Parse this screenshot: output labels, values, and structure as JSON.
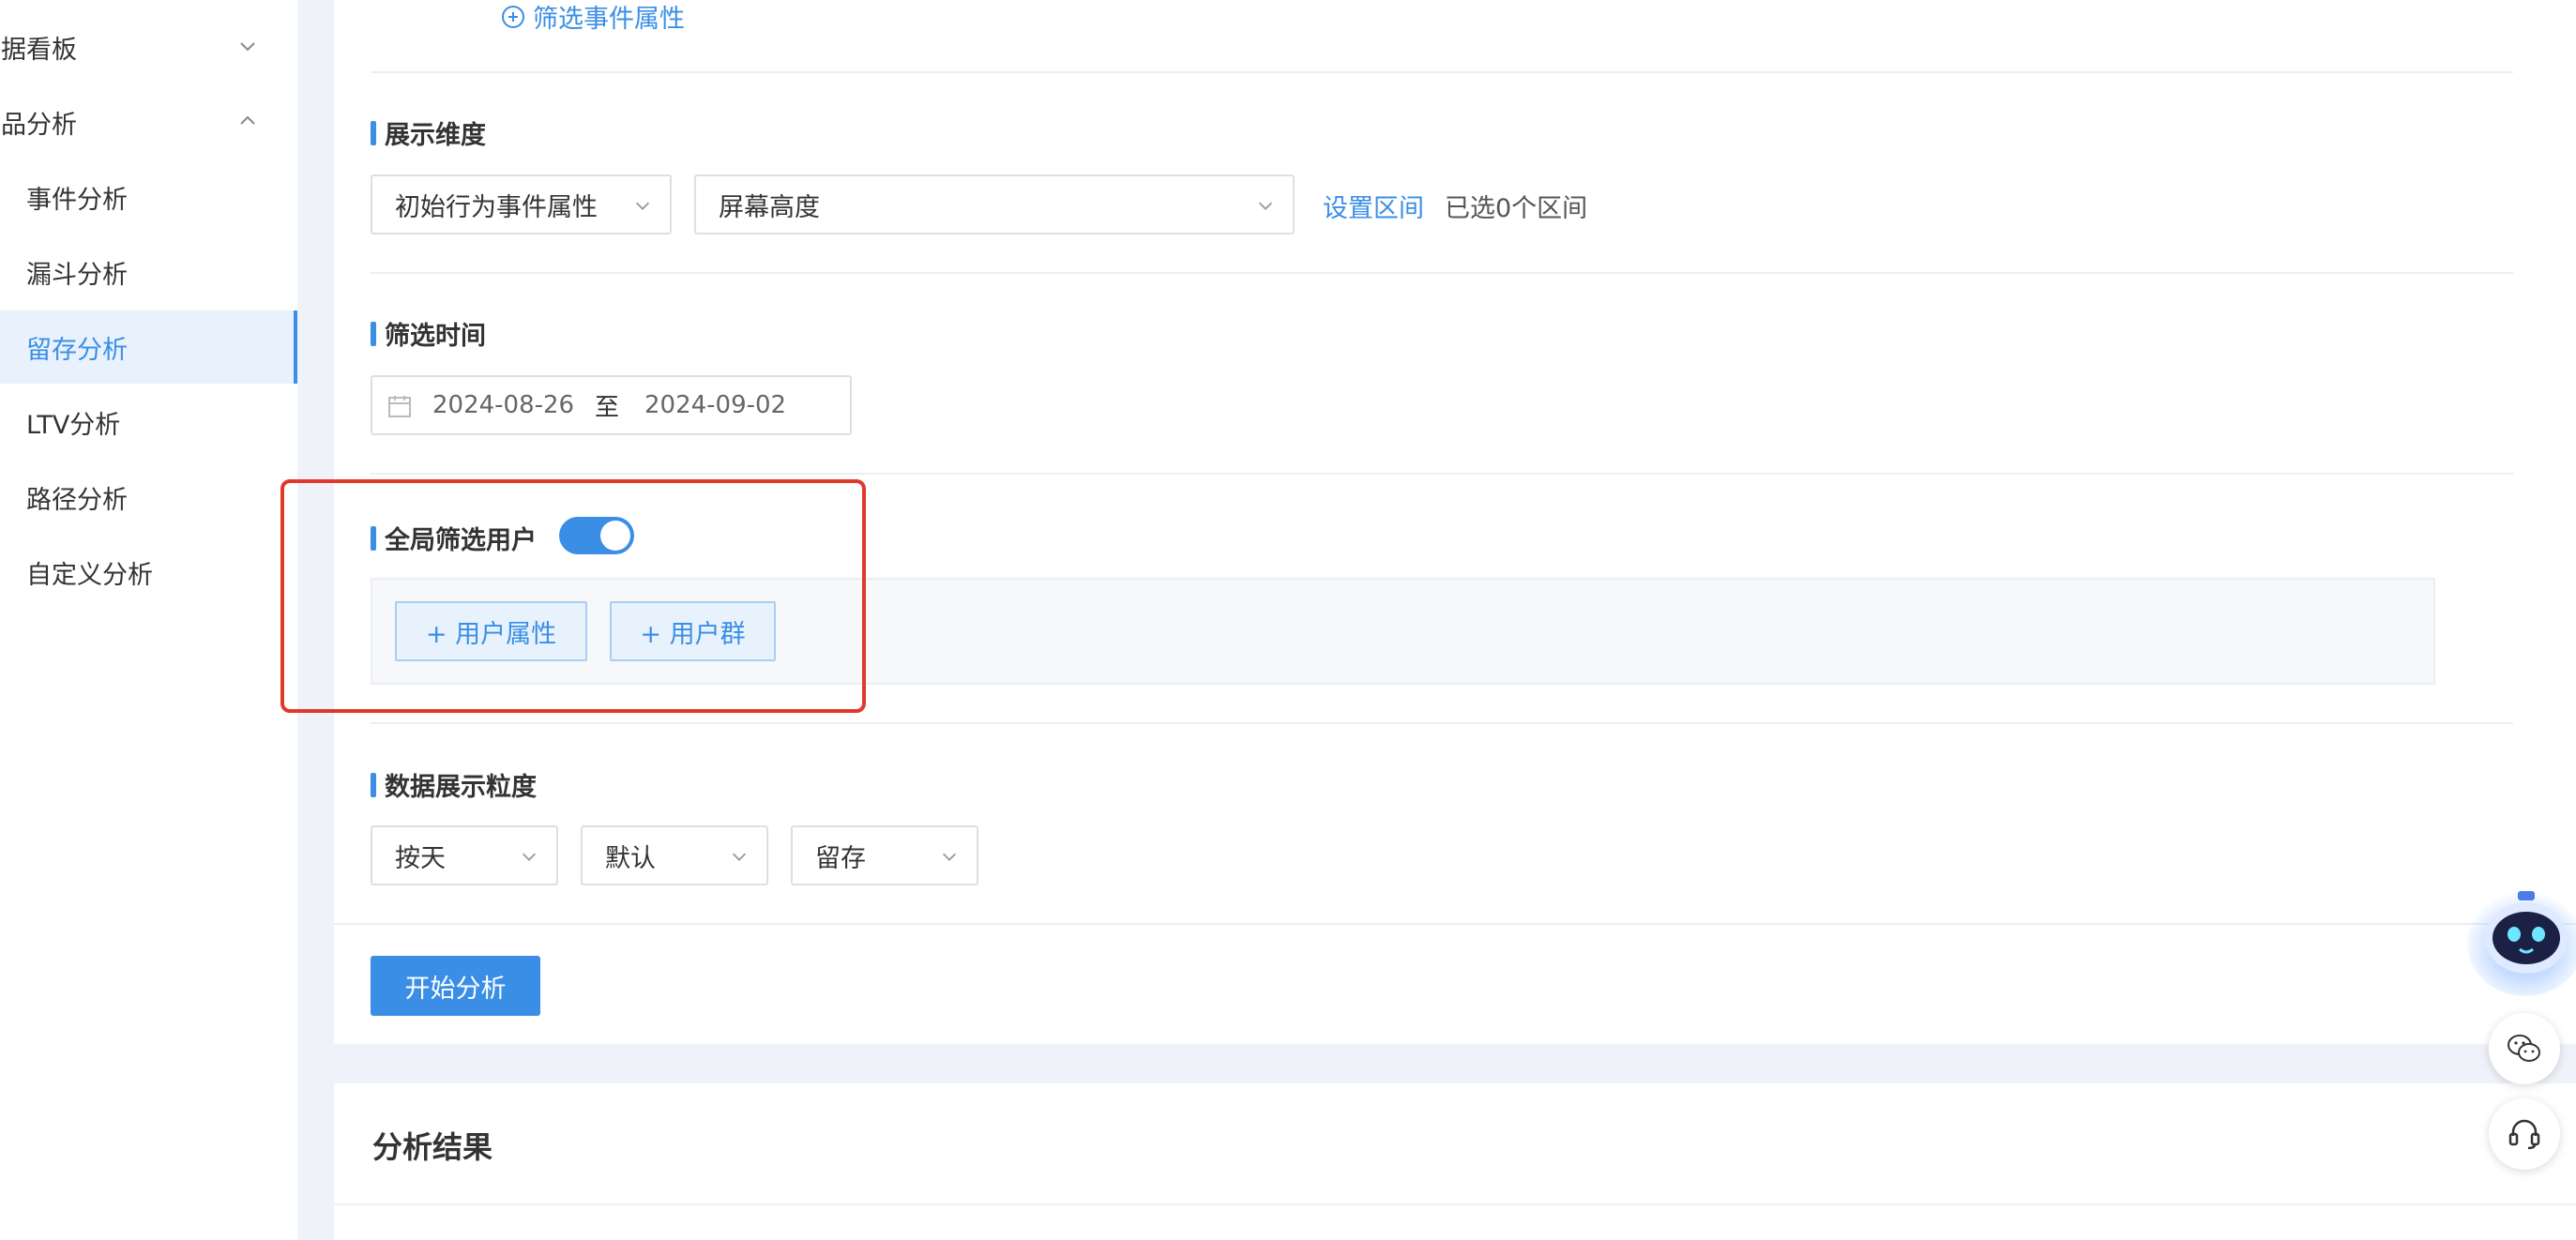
{
  "sidebar": {
    "groups": [
      {
        "label": "数据看板",
        "expanded": false
      },
      {
        "label": "产品分析",
        "expanded": true
      }
    ],
    "items": [
      {
        "label": "事件分析"
      },
      {
        "label": "漏斗分析"
      },
      {
        "label": "留存分析",
        "active": true
      },
      {
        "label": "LTV分析"
      },
      {
        "label": "路径分析"
      },
      {
        "label": "自定义分析"
      }
    ]
  },
  "filter_event_attr_link": "筛选事件属性",
  "dimension": {
    "title": "展示维度",
    "type_select": "初始行为事件属性",
    "field_select": "屏幕高度",
    "set_range_link": "设置区间",
    "selected_text": "已选0个区间"
  },
  "time": {
    "title": "筛选时间",
    "start": "2024-08-26",
    "separator": "至",
    "end": "2024-09-02"
  },
  "global_filter": {
    "title": "全局筛选用户",
    "enabled": true,
    "user_attr_button": "+ 用户属性",
    "user_group_button": "+ 用户群"
  },
  "granularity": {
    "title": "数据展示粒度",
    "period": "按天",
    "mode": "默认",
    "metric": "留存"
  },
  "start_button": "开始分析",
  "result_title": "分析结果",
  "colors": {
    "accent": "#3a8ee6",
    "highlight": "#e0392b"
  }
}
